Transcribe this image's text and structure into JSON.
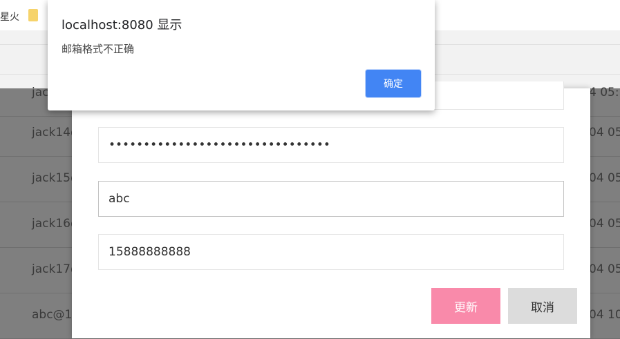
{
  "browser": {
    "bookmark_partial": "星火"
  },
  "background_rows": [
    {
      "email": "jack",
      "time": "4 05:"
    },
    {
      "email": "jack14@",
      "time": "04 05:"
    },
    {
      "email": "jack15@",
      "time": "04 05:"
    },
    {
      "email": "jack16@",
      "time": "04 05:"
    },
    {
      "email": "jack17@",
      "time": "04 05:"
    },
    {
      "email": "abc@1",
      "time": "04 10:"
    }
  ],
  "modal": {
    "password_value": "••••••••••••••••••••••••••••••••",
    "email_value": "abc",
    "phone_value": "15888888888",
    "update_label": "更新",
    "cancel_label": "取消"
  },
  "alert": {
    "title": "localhost:8080 显示",
    "message": "邮箱格式不正确",
    "ok_label": "确定"
  },
  "colors": {
    "update_button": "#f98aaa",
    "cancel_button": "#dcdcdc",
    "alert_ok": "#4285f4",
    "overlay": "#7f7f7f"
  }
}
